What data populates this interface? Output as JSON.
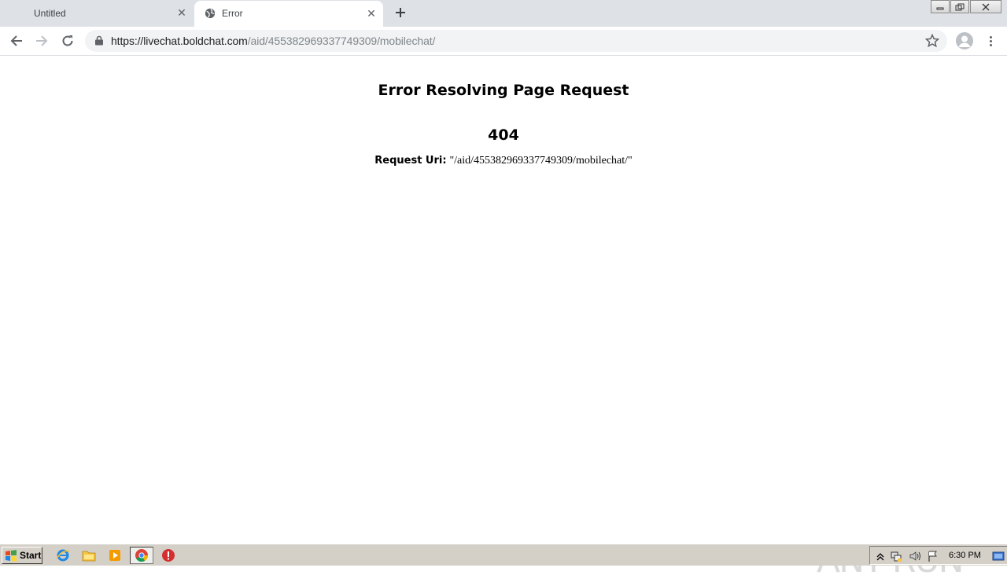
{
  "browser": {
    "tabs": [
      {
        "title": "Untitled",
        "active": false
      },
      {
        "title": "Error",
        "active": true
      }
    ],
    "url_host": "https://livechat.boldchat.com",
    "url_path": "/aid/455382969337749309/mobilechat/"
  },
  "page": {
    "title": "Error Resolving Page Request",
    "code": "404",
    "uri_label": "Request Uri:",
    "uri_value": "\"/aid/455382969337749309/mobilechat/\""
  },
  "watermark": {
    "text": "ANY RUN"
  },
  "taskbar": {
    "start_label": "Start",
    "clock": "6:30 PM"
  },
  "colors": {
    "tabstrip": "#dee1e6",
    "omnibox": "#f1f3f4",
    "taskbar": "#d4d0c8"
  }
}
